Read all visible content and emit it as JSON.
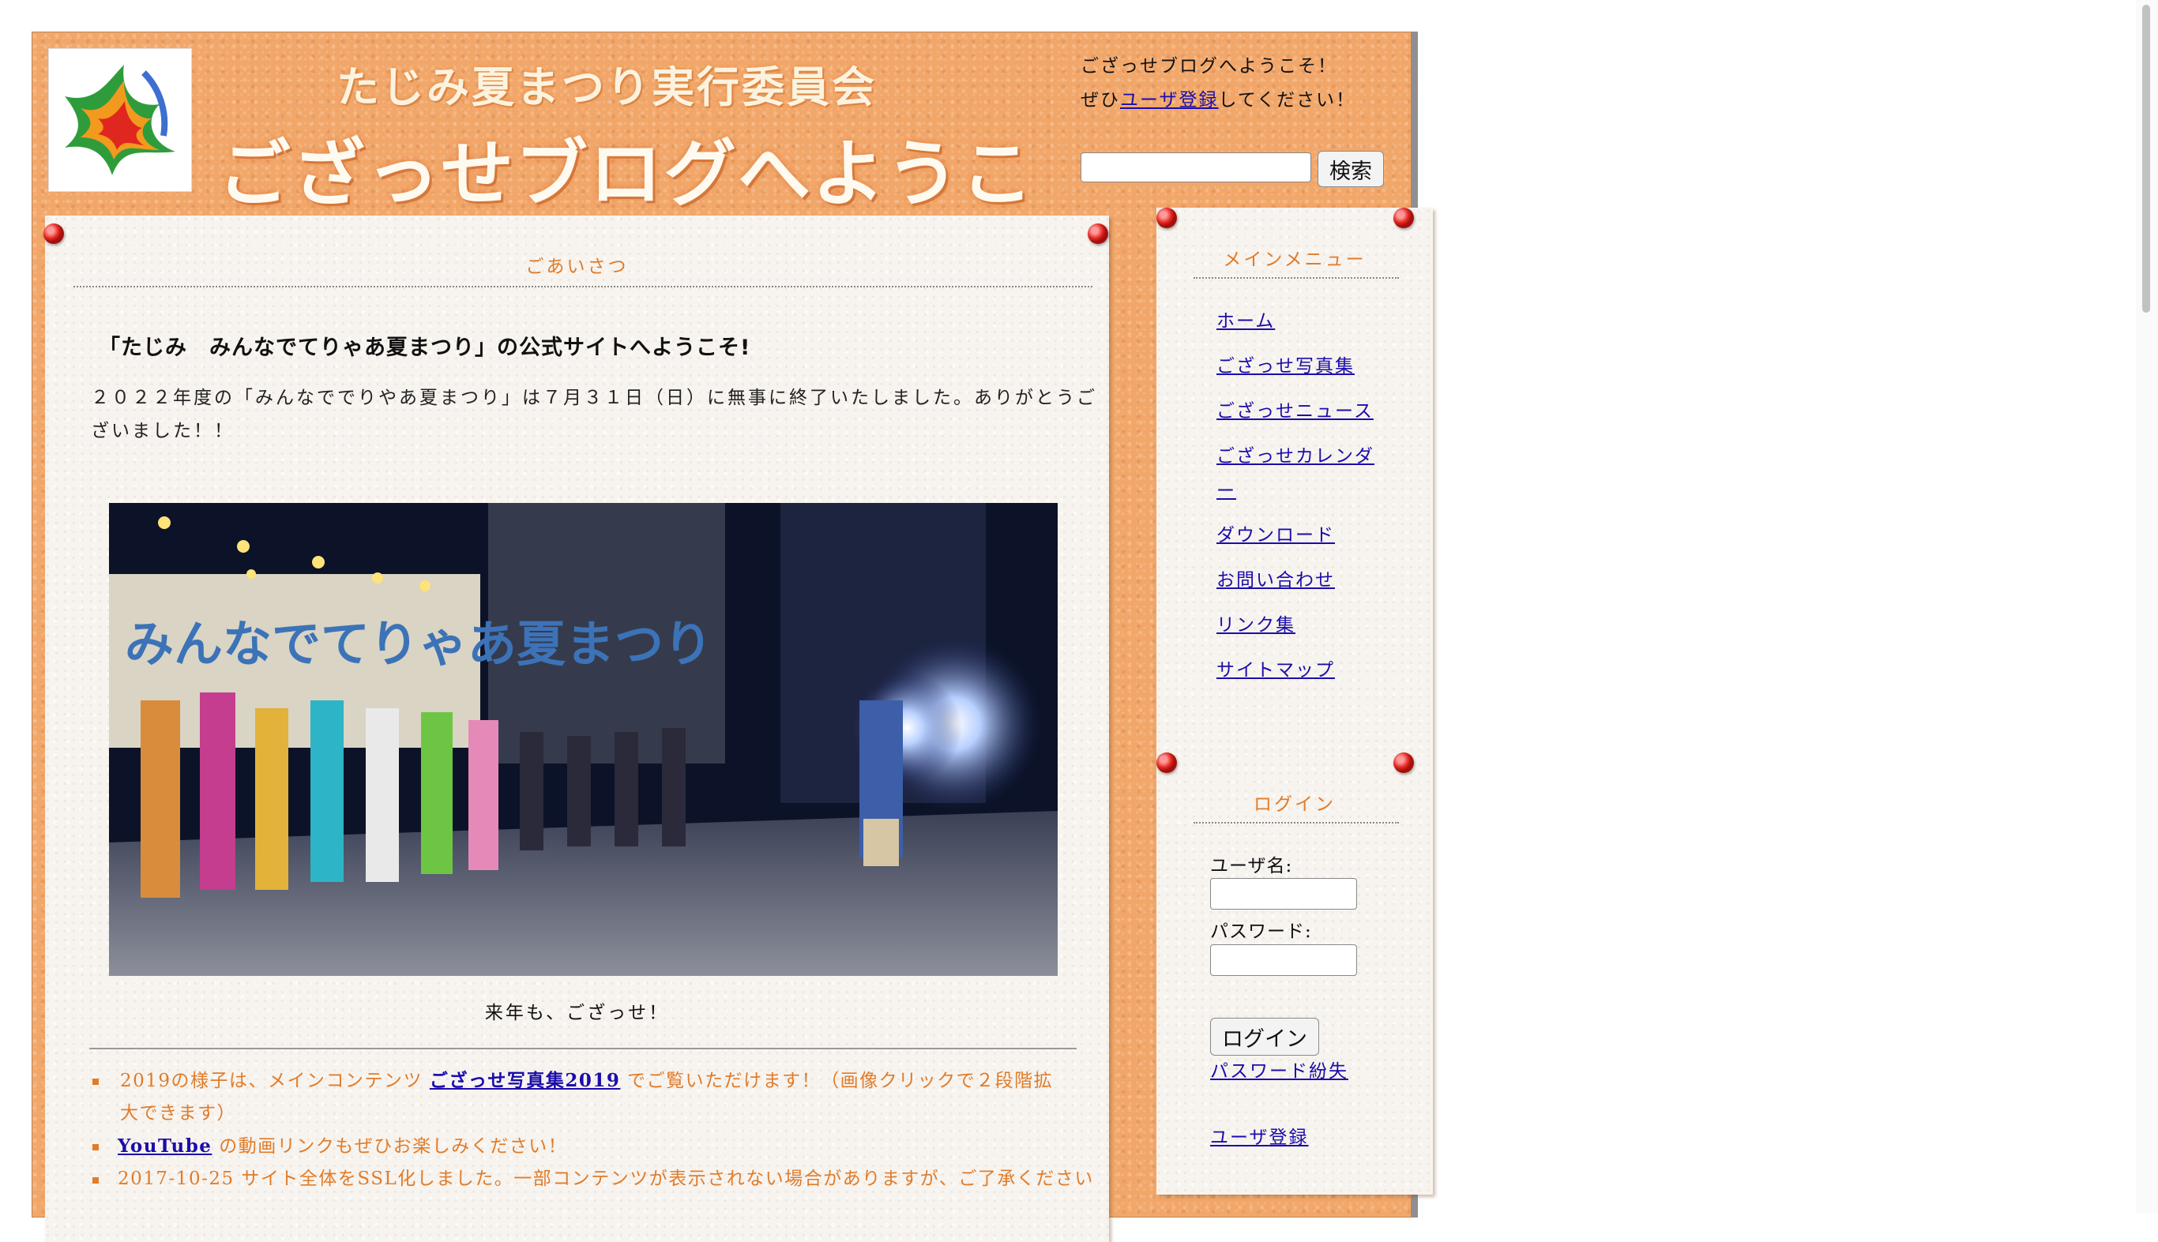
{
  "header": {
    "site_name": "たじみ夏まつり実行委員会",
    "slogan": "ござっせブログへようこそ！",
    "welcome_line1": "ござっせブログへようこそ！",
    "welcome_prefix": "ぜひ",
    "register_link": "ユーザ登録",
    "welcome_suffix": "してください！",
    "search_placeholder": "",
    "search_button": "検索"
  },
  "center": {
    "block_title": "ごあいさつ",
    "heading": "「たじみ　みんなでてりゃあ夏まつり」の公式サイトへようこそ!",
    "intro": "２０２２年度の「みんなででりやあ夏まつり」は７月３１日（日）に無事に終了いたしました。ありがとうございました！！",
    "photo_banner_text": "みんなでてりゃあ夏まつり",
    "caption": "来年も、ござっせ！",
    "news": [
      {
        "pre": "2019の様子は、メインコンテンツ ",
        "link": "ござっせ写真集2019",
        "post": " でご覧いただけます！（画像クリックで２段階拡大できます）"
      },
      {
        "pre": "",
        "link": "YouTube",
        "post": " の動画リンクもぜひお楽しみください！"
      },
      {
        "pre": "2017-10-25 サイト全体をSSL化しました。一部コンテンツが表示されない場合がありますが、ご了承ください",
        "link": "",
        "post": ""
      }
    ]
  },
  "sidebar": {
    "menu_title": "メインメニュー",
    "menu_items": [
      {
        "label": "ホーム"
      },
      {
        "label": "ござっせ写真集"
      },
      {
        "label": "ござっせニュース"
      },
      {
        "label": "ござっせカレンダー"
      },
      {
        "label": "ダウンロード"
      },
      {
        "label": "お問い合わせ"
      },
      {
        "label": "リンク集"
      },
      {
        "label": "サイトマップ"
      }
    ],
    "login_title": "ログイン",
    "username_label": "ユーザ名:",
    "password_label": "パスワード:",
    "login_button": "ログイン",
    "lost_password": "パスワード紛失",
    "register": "ユーザ登録"
  },
  "colors": {
    "page_bg": "#f2a76a",
    "block_title": "#e07c2a",
    "link": "#1a0dab",
    "pin": "#e2261e"
  }
}
